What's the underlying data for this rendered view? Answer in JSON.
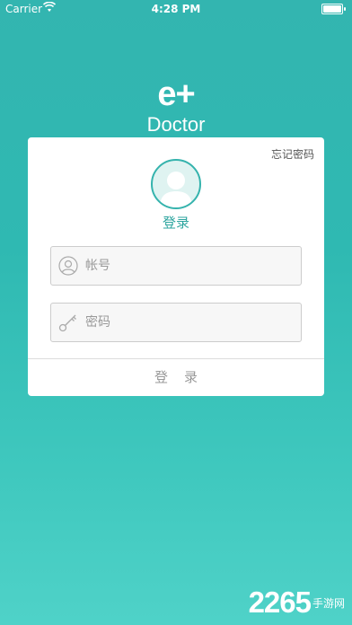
{
  "status_bar": {
    "carrier": "Carrier",
    "time": "4:28 PM"
  },
  "logo": {
    "mark": "e+",
    "subtitle": "Doctor"
  },
  "login_card": {
    "forgot_password": "忘记密码",
    "title": "登录",
    "username_placeholder": "帐号",
    "password_placeholder": "密码",
    "submit_label": "登录"
  },
  "watermark": {
    "number": "2265",
    "text": "手游网"
  },
  "colors": {
    "accent": "#2ea59f",
    "background_top": "#33b5b0",
    "background_bottom": "#4fd2c8"
  }
}
